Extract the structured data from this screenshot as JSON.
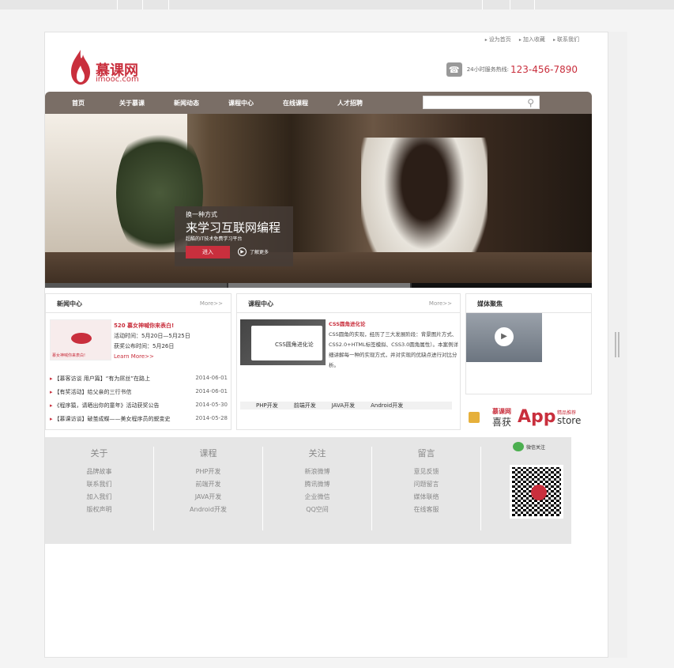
{
  "topnav": [
    "设为首页",
    "加入收藏",
    "联系我们"
  ],
  "logo": {
    "cn": "慕课网",
    "en": "imooc.com"
  },
  "hotline": {
    "label": "24小时服务热线:",
    "number": "123-456-7890"
  },
  "nav": [
    "首页",
    "关于慕课",
    "新闻动态",
    "课程中心",
    "在线课程",
    "人才招聘"
  ],
  "banner": {
    "line1": "换一种方式",
    "line2": "来学习互联网编程",
    "line3": "超酷的IT技术免费学习平台",
    "enter": "进入",
    "more": "了解更多"
  },
  "news": {
    "title": "新闻中心",
    "more": "More>>",
    "feature": {
      "headline": "520 慕女神喊你来表白!",
      "l1": "活动时间：5月20日—5月25日",
      "l2": "获奖公布时间：5月26日",
      "learn": "Learn More>>",
      "caption": "慕女神喊你来表白!"
    },
    "items": [
      {
        "t": "【慕客访谈 用户篇】“有为屌丝”在路上",
        "d": "2014-06-01"
      },
      {
        "t": "【有奖活动】给父亲的三行书信",
        "d": "2014-06-01"
      },
      {
        "t": "《程序猿，请晒出你的童年》活动获奖公告",
        "d": "2014-05-30"
      },
      {
        "t": "【慕课访谈】破茧成蝶——美女程序员的蜕变史",
        "d": "2014-05-28"
      }
    ]
  },
  "course": {
    "title": "课程中心",
    "more": "More>>",
    "img_label": "CSS圆角进化论",
    "headline": "CSS圆角进化论",
    "desc": "CSS圆角的实现，经历了三大发展阶段：背景图片方式、CSS2.0+HTML标签模拟、CSS3.0圆角属性）。本案例详细讲解每一种的实现方式，并对实现的优缺点进行对比分析。",
    "tabs": [
      "PHP开发",
      "前端开发",
      "JAVA开发",
      "Android开发"
    ]
  },
  "media": {
    "title": "媒体聚焦",
    "app": {
      "c1": "慕课网",
      "c2": "喜获",
      "big": "App",
      "tag": "精品推荐",
      "store": "store"
    }
  },
  "footer": {
    "cols": [
      {
        "h": "关于",
        "items": [
          "品牌故事",
          "联系我们",
          "加入我们",
          "版权声明"
        ]
      },
      {
        "h": "课程",
        "items": [
          "PHP开发",
          "前端开发",
          "JAVA开发",
          "Android开发"
        ]
      },
      {
        "h": "关注",
        "items": [
          "新浪微博",
          "腾讯微博",
          "企业微信",
          "QQ空间"
        ]
      },
      {
        "h": "留言",
        "items": [
          "意见反馈",
          "问题留言",
          "媒体联络",
          "在线客服"
        ]
      }
    ],
    "wechat": "微信关注"
  },
  "colors": {
    "brand": "#c92f3d",
    "nav": "#7a6e66",
    "footer": "#e6e6e6"
  }
}
